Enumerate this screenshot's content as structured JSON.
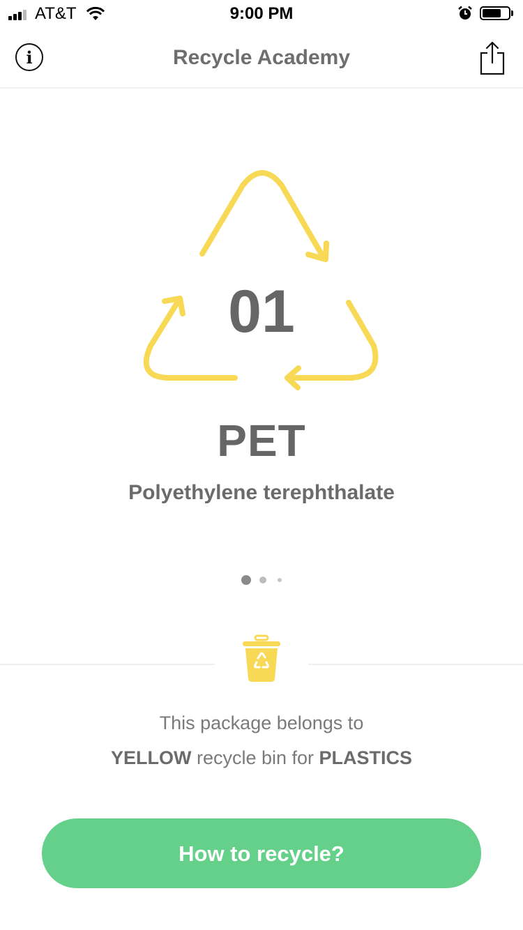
{
  "status_bar": {
    "carrier": "AT&T",
    "time": "9:00 PM",
    "battery_level": 0.75
  },
  "nav": {
    "title": "Recycle Academy",
    "info_icon": "info-icon",
    "share_icon": "share-icon"
  },
  "material": {
    "code": "01",
    "abbreviation": "PET",
    "full_name": "Polyethylene terephthalate"
  },
  "pager": {
    "count": 3,
    "active_index": 0
  },
  "bin": {
    "line1": "This package belongs to",
    "color_word": "YELLOW",
    "middle_text": " recycle bin for ",
    "category": "PLASTICS",
    "icon": "recycle-bin-icon"
  },
  "cta": {
    "label": "How to recycle?"
  },
  "colors": {
    "accent_yellow": "#F7D955",
    "button_green": "#64D08A",
    "text_gray": "#666666"
  }
}
